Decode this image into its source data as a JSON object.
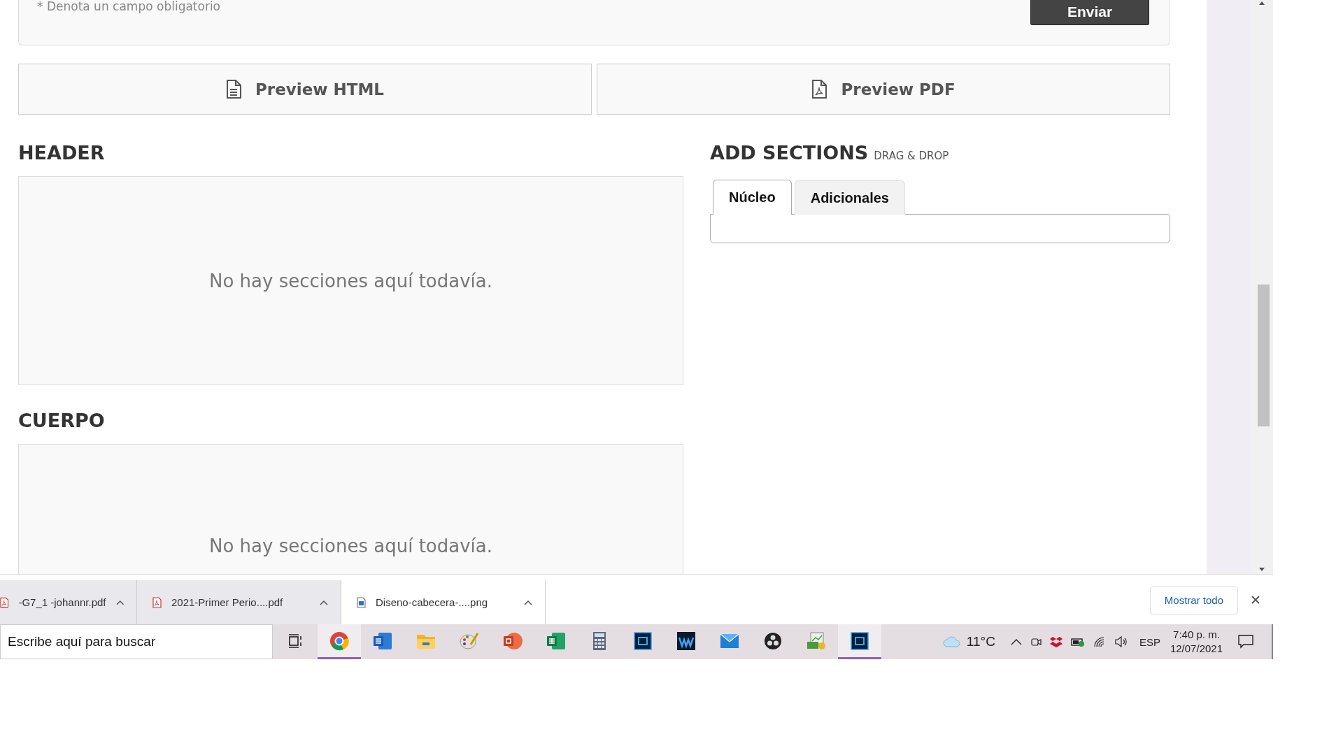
{
  "form": {
    "required_note": "* Denota un campo obligatorio",
    "submit_button": "Enviar"
  },
  "preview_buttons": [
    {
      "label": "Preview HTML",
      "kind": "html"
    },
    {
      "label": "Preview PDF",
      "kind": "pdf"
    }
  ],
  "header_section": {
    "title": "HEADER",
    "empty_message": "No hay secciones aquí todavía."
  },
  "add_sections": {
    "title": "ADD SECTIONS",
    "subtitle": "DRAG & DROP",
    "tabs": [
      {
        "label": "Núcleo",
        "selected": true
      },
      {
        "label": "Adicionales",
        "selected": false
      }
    ]
  },
  "body_section": {
    "title": "CUERPO",
    "empty_message": "No hay secciones aquí todavía."
  },
  "downloads": {
    "items": [
      {
        "filename": "-G7_1 -johannr.pdf",
        "kind": "pdf",
        "selected": false
      },
      {
        "filename": "2021-Primer Perio....pdf",
        "kind": "pdf",
        "selected": false
      },
      {
        "filename": "Diseno-cabecera-....png",
        "kind": "image",
        "selected": true
      }
    ],
    "show_all_button": "Mostrar todo"
  },
  "taskbar": {
    "search_placeholder": "Escribe aquí para buscar",
    "apps": [
      {
        "kind": "taskview",
        "active": false
      },
      {
        "kind": "chrome",
        "active": true
      },
      {
        "kind": "word",
        "active": false
      },
      {
        "kind": "explorer",
        "active": false
      },
      {
        "kind": "paint",
        "active": false
      },
      {
        "kind": "powerpoint",
        "active": false
      },
      {
        "kind": "excel",
        "active": false
      },
      {
        "kind": "calculator",
        "active": false
      },
      {
        "kind": "photoshop",
        "active": false
      },
      {
        "kind": "waves",
        "active": false
      },
      {
        "kind": "mail",
        "active": false
      },
      {
        "kind": "obs",
        "active": false
      },
      {
        "kind": "money",
        "active": false
      },
      {
        "kind": "photoshop",
        "active": true
      }
    ],
    "temperature": "11°C",
    "language": "ESP",
    "time": "7:40 p. m.",
    "date": "12/07/2021"
  }
}
